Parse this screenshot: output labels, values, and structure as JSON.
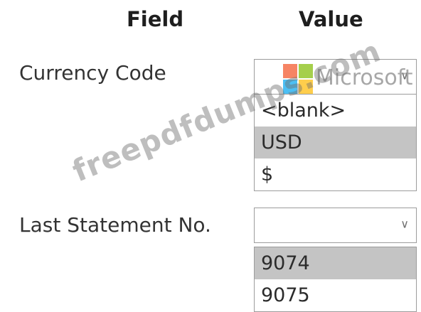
{
  "headers": {
    "field": "Field",
    "value": "Value"
  },
  "currency_code": {
    "label": "Currency Code",
    "selected_value": "",
    "options": [
      "<blank>",
      "USD",
      "$"
    ],
    "highlighted_index": 1
  },
  "last_statement_no": {
    "label": "Last Statement No.",
    "selected_value": "",
    "options": [
      "9074",
      "9075"
    ],
    "highlighted_index": 0
  },
  "watermarks": {
    "logo_text": "Microsoft",
    "site_text": "freepdfdumps.com",
    "logo_colors": [
      "#f25022",
      "#7fba00",
      "#00a4ef",
      "#ffb900"
    ]
  },
  "icons": {
    "dropdown": "chevron-down-icon"
  }
}
